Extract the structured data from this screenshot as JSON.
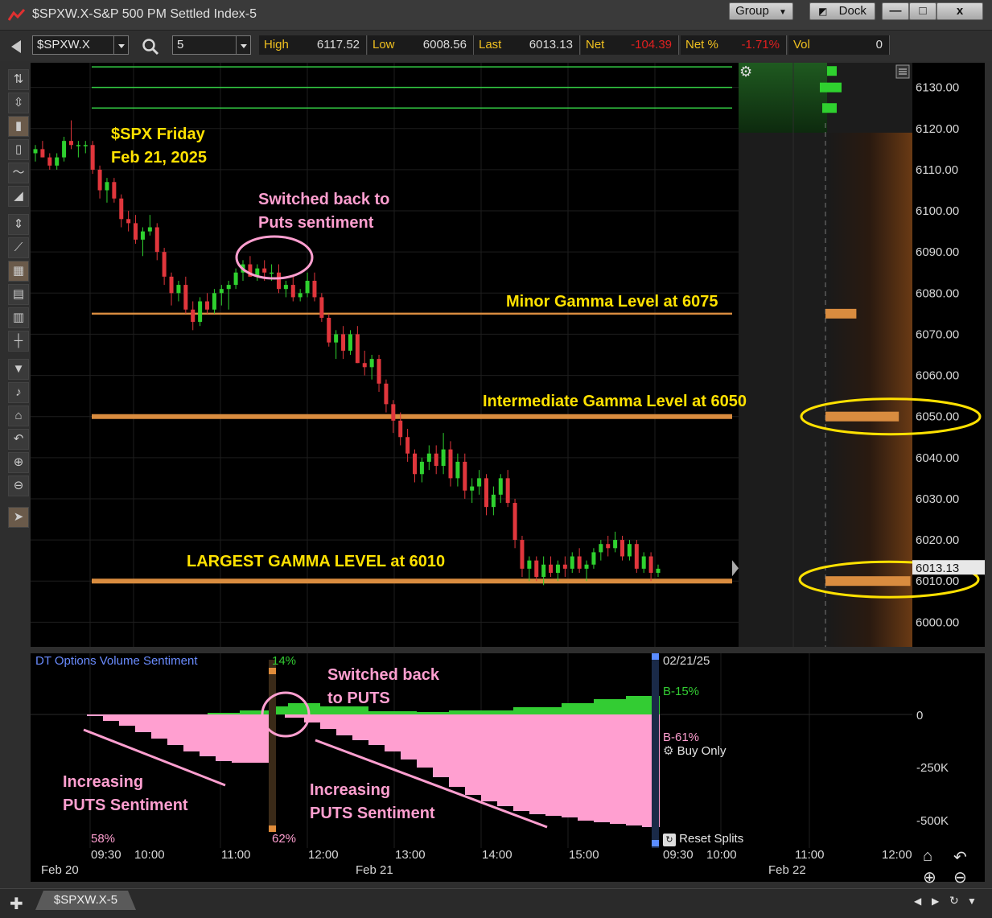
{
  "window": {
    "title": "$SPXW.X-S&P 500 PM Settled Index-5",
    "group_label": "Group",
    "dock_label": "Dock",
    "minimize_label": "—",
    "maximize_label": "□",
    "close_label": "x"
  },
  "toolbar": {
    "symbol": "$SPXW.X",
    "interval": "5",
    "quotes": [
      {
        "label": "High",
        "value": "6117.52",
        "negative": false
      },
      {
        "label": "Low",
        "value": "6008.56",
        "negative": false
      },
      {
        "label": "Last",
        "value": "6013.13",
        "negative": false
      },
      {
        "label": "Net",
        "value": "-104.39",
        "negative": true
      },
      {
        "label": "Net %",
        "value": "-1.71%",
        "negative": true
      },
      {
        "label": "Vol",
        "value": "0",
        "negative": false
      }
    ]
  },
  "colors": {
    "up": "#2fd12f",
    "down": "#e0363c",
    "gamma": "#d98c3f",
    "yellow": "#ffe100",
    "pink": "#ff9fd0",
    "green_line": "#33cc44",
    "sent_green": "#33cc33",
    "sent_pink": "#ff9fd0"
  },
  "annotations": {
    "spx_title_line1": "$SPX Friday",
    "spx_title_line2": "Feb 21, 2025",
    "switched_line1": "Switched back to",
    "switched_line2": "Puts sentiment",
    "minor_gamma": "Minor Gamma Level at 6075",
    "intermediate_gamma": "Intermediate  Gamma Level at 6050",
    "largest_gamma": "LARGEST GAMMA LEVEL at 6010"
  },
  "chart_data": {
    "type": "candlestick",
    "ylim": [
      5994,
      6136
    ],
    "y_ticks": [
      "6130.00",
      "6120.00",
      "6110.00",
      "6100.00",
      "6090.00",
      "6080.00",
      "6070.00",
      "6060.00",
      "6050.00",
      "6040.00",
      "6030.00",
      "6020.00",
      "6010.00",
      "6000.00"
    ],
    "last_price_label": "6013.13",
    "gamma_levels": [
      6075,
      6050,
      6010
    ],
    "resistance_lines": [
      6135,
      6130,
      6125
    ],
    "candles": [
      [
        6114,
        6116,
        6112,
        6115
      ],
      [
        6115,
        6117,
        6113,
        6113
      ],
      [
        6113,
        6114,
        6110,
        6111
      ],
      [
        6111,
        6114,
        6110,
        6113
      ],
      [
        6113,
        6118,
        6112,
        6117
      ],
      [
        6117,
        6122,
        6115,
        6116
      ],
      [
        6116,
        6117,
        6113,
        6116
      ],
      [
        6116,
        6117,
        6114,
        6116
      ],
      [
        6116,
        6117,
        6109,
        6110
      ],
      [
        6110,
        6111,
        6103,
        6105
      ],
      [
        6105,
        6108,
        6102,
        6107
      ],
      [
        6107,
        6108,
        6102,
        6103
      ],
      [
        6103,
        6104,
        6096,
        6098
      ],
      [
        6098,
        6100,
        6095,
        6097
      ],
      [
        6097,
        6099,
        6092,
        6093
      ],
      [
        6093,
        6096,
        6089,
        6095
      ],
      [
        6095,
        6099,
        6094,
        6096
      ],
      [
        6096,
        6097,
        6088,
        6090
      ],
      [
        6090,
        6091,
        6082,
        6084
      ],
      [
        6084,
        6085,
        6077,
        6080
      ],
      [
        6080,
        6083,
        6078,
        6082
      ],
      [
        6082,
        6084,
        6075,
        6076
      ],
      [
        6076,
        6078,
        6071,
        6073
      ],
      [
        6073,
        6079,
        6072,
        6078
      ],
      [
        6078,
        6080,
        6075,
        6076
      ],
      [
        6076,
        6081,
        6075,
        6080
      ],
      [
        6080,
        6082,
        6077,
        6081
      ],
      [
        6081,
        6083,
        6076,
        6082
      ],
      [
        6082,
        6086,
        6081,
        6085
      ],
      [
        6085,
        6088,
        6083,
        6087
      ],
      [
        6087,
        6089,
        6084,
        6084
      ],
      [
        6084,
        6087,
        6083,
        6086
      ],
      [
        6086,
        6088,
        6083,
        6085
      ],
      [
        6085,
        6087,
        6083,
        6085
      ],
      [
        6085,
        6087,
        6080,
        6081
      ],
      [
        6081,
        6083,
        6079,
        6082
      ],
      [
        6082,
        6084,
        6078,
        6079
      ],
      [
        6079,
        6081,
        6078,
        6080
      ],
      [
        6080,
        6085,
        6079,
        6083
      ],
      [
        6083,
        6085,
        6078,
        6079
      ],
      [
        6079,
        6080,
        6073,
        6074
      ],
      [
        6074,
        6075,
        6067,
        6068
      ],
      [
        6068,
        6071,
        6064,
        6070
      ],
      [
        6070,
        6072,
        6064,
        6066
      ],
      [
        6066,
        6071,
        6065,
        6070
      ],
      [
        6070,
        6072,
        6063,
        6063
      ],
      [
        6063,
        6066,
        6060,
        6062
      ],
      [
        6062,
        6065,
        6059,
        6064
      ],
      [
        6064,
        6065,
        6056,
        6058
      ],
      [
        6058,
        6059,
        6051,
        6053
      ],
      [
        6053,
        6054,
        6046,
        6049
      ],
      [
        6049,
        6051,
        6043,
        6045
      ],
      [
        6045,
        6047,
        6039,
        6041
      ],
      [
        6041,
        6042,
        6034,
        6036
      ],
      [
        6036,
        6040,
        6034,
        6039
      ],
      [
        6039,
        6043,
        6037,
        6041
      ],
      [
        6041,
        6043,
        6036,
        6038
      ],
      [
        6038,
        6046,
        6036,
        6042
      ],
      [
        6042,
        6044,
        6033,
        6035
      ],
      [
        6035,
        6041,
        6033,
        6039
      ],
      [
        6039,
        6041,
        6030,
        6032
      ],
      [
        6032,
        6035,
        6029,
        6033
      ],
      [
        6033,
        6037,
        6031,
        6035
      ],
      [
        6035,
        6036,
        6026,
        6028
      ],
      [
        6028,
        6033,
        6026,
        6031
      ],
      [
        6031,
        6036,
        6029,
        6035
      ],
      [
        6035,
        6037,
        6028,
        6029
      ],
      [
        6029,
        6030,
        6018,
        6020
      ],
      [
        6020,
        6021,
        6011,
        6013
      ],
      [
        6013,
        6016,
        6010,
        6015
      ],
      [
        6015,
        6016,
        6010,
        6011
      ],
      [
        6011,
        6016,
        6009,
        6014
      ],
      [
        6014,
        6016,
        6011,
        6012
      ],
      [
        6012,
        6015,
        6010,
        6014
      ],
      [
        6014,
        6016,
        6011,
        6013
      ],
      [
        6013,
        6017,
        6012,
        6016
      ],
      [
        6016,
        6018,
        6012,
        6013
      ],
      [
        6013,
        6015,
        6010,
        6014
      ],
      [
        6014,
        6018,
        6013,
        6017
      ],
      [
        6017,
        6020,
        6015,
        6019
      ],
      [
        6019,
        6021,
        6016,
        6018
      ],
      [
        6018,
        6022,
        6017,
        6020
      ],
      [
        6020,
        6021,
        6015,
        6016
      ],
      [
        6016,
        6020,
        6015,
        6019
      ],
      [
        6019,
        6020,
        6012,
        6013
      ],
      [
        6013,
        6017,
        6012,
        6016
      ],
      [
        6016,
        6017,
        6010,
        6012
      ],
      [
        6012,
        6014,
        6011,
        6013
      ]
    ]
  },
  "gamma_profile": {
    "green_bars": [
      {
        "price": 6134,
        "size": 0.25
      },
      {
        "price": 6130,
        "size": 0.75
      },
      {
        "price": 6125,
        "size": 0.5
      }
    ],
    "orange_bars": [
      {
        "price": 6075,
        "size": 0.8
      },
      {
        "price": 6050,
        "size": 1.9
      },
      {
        "price": 6010,
        "size": 2.2
      }
    ]
  },
  "sentiment": {
    "title": "DT Options Volume Sentiment",
    "date_label": "02/21/25",
    "green_pct_label": "B-15%",
    "pink_pct_label": "B-61%",
    "buy_only_label": "Buy Only",
    "reset_splits_label": "Reset Splits",
    "split_top_pct": "14%",
    "split_bottom_pct": "62%",
    "left_bottom_pct": "58%",
    "y_ticks": [
      "0",
      "-250K",
      "-500K"
    ],
    "switched_line1": "Switched back",
    "switched_line2": "to PUTS",
    "increasing_left_line1": "Increasing",
    "increasing_left_line2": "PUTS Sentiment",
    "increasing_right_line1": "Increasing",
    "increasing_right_line2": "PUTS Sentiment"
  },
  "time_axis": {
    "times": [
      "09:30",
      "10:00",
      "11:00",
      "12:00",
      "13:00",
      "14:00",
      "15:00",
      "09:30",
      "10:00",
      "11:00",
      "12:00"
    ],
    "dates": [
      "Feb 20",
      "Feb 21",
      "Feb 22"
    ]
  },
  "tabs": [
    {
      "label": "$SPXW.X-5"
    }
  ]
}
